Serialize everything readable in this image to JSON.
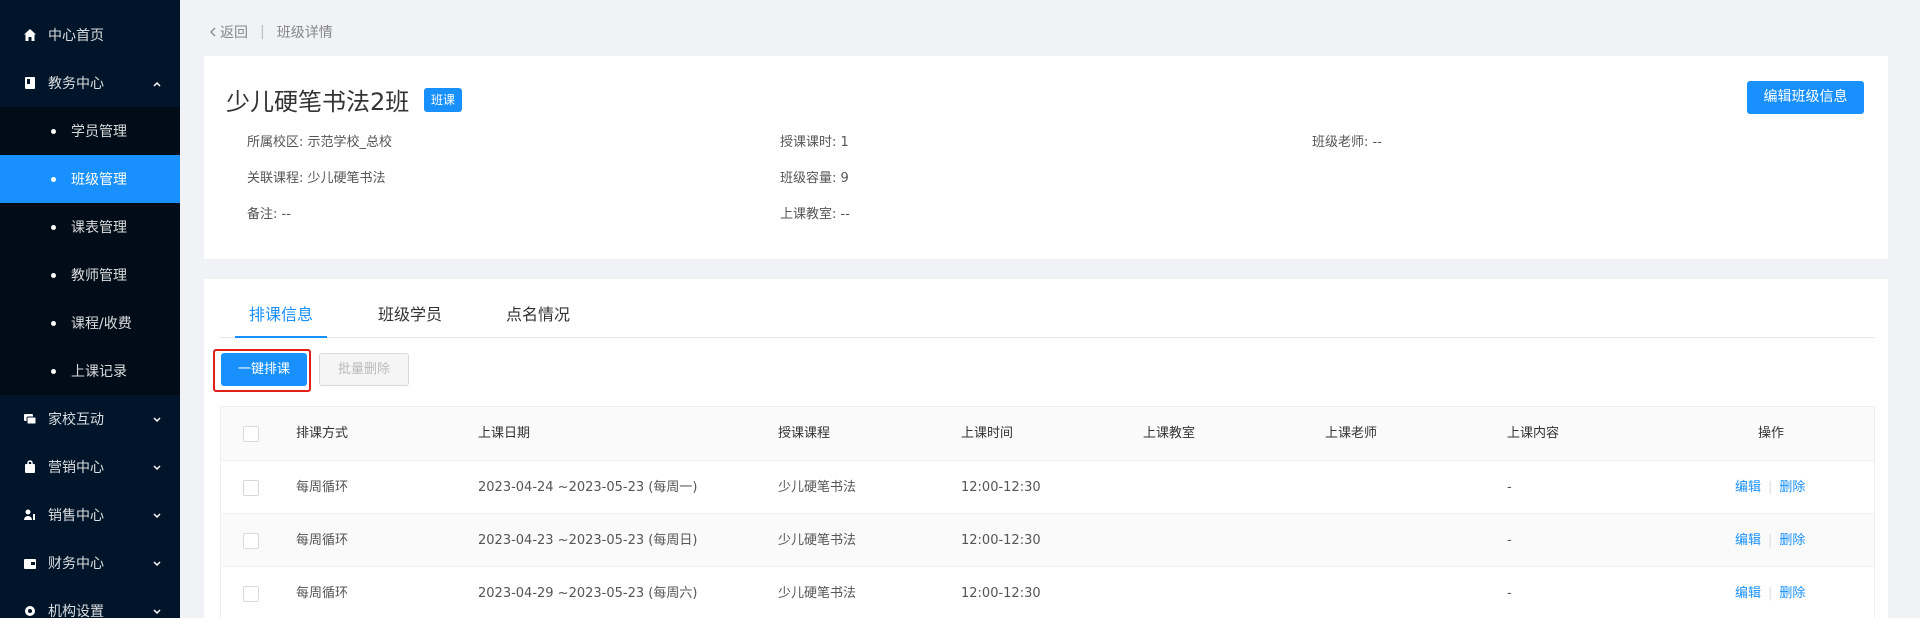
{
  "sidebar": {
    "home": "中心首页",
    "academic": "教务中心",
    "academic_items": [
      "学员管理",
      "班级管理",
      "课表管理",
      "教师管理",
      "课程/收费",
      "上课记录"
    ],
    "home_school": "家校互动",
    "marketing": "营销中心",
    "sales": "销售中心",
    "finance": "财务中心",
    "org_settings": "机构设置"
  },
  "breadcrumb": {
    "back": "返回",
    "separator": "|",
    "current": "班级详情"
  },
  "class_info": {
    "title": "少儿硬笔书法2班",
    "tag": "班课",
    "edit_button": "编辑班级信息",
    "campus": "所属校区: 示范学校_总校",
    "hours": "授课课时: 1",
    "teacher": "班级老师: --",
    "course": "关联课程: 少儿硬笔书法",
    "capacity": "班级容量: 9",
    "note": "备注: --",
    "classroom": "上课教室: --"
  },
  "tabs": [
    "排课信息",
    "班级学员",
    "点名情况"
  ],
  "buttons": {
    "one_click": "一键排课",
    "batch_delete": "批量删除"
  },
  "table": {
    "headers": [
      "排课方式",
      "上课日期",
      "授课课程",
      "上课时间",
      "上课教室",
      "上课老师",
      "上课内容",
      "操作"
    ],
    "rows": [
      {
        "mode": "每周循环",
        "date": "2023-04-24 ~2023-05-23 (每周一)",
        "course": "少儿硬笔书法",
        "time": "12:00-12:30",
        "classroom": "",
        "teacher": "",
        "content": "-",
        "edit": "编辑",
        "delete": "删除"
      },
      {
        "mode": "每周循环",
        "date": "2023-04-23 ~2023-05-23 (每周日)",
        "course": "少儿硬笔书法",
        "time": "12:00-12:30",
        "classroom": "",
        "teacher": "",
        "content": "-",
        "edit": "编辑",
        "delete": "删除"
      },
      {
        "mode": "每周循环",
        "date": "2023-04-29 ~2023-05-23 (每周六)",
        "course": "少儿硬笔书法",
        "time": "12:00-12:30",
        "classroom": "",
        "teacher": "",
        "content": "-",
        "edit": "编辑",
        "delete": "删除"
      }
    ]
  },
  "colors": {
    "sidebar_bg": "#001529",
    "submenu_bg": "#000c17",
    "primary": "#1890ff",
    "highlight_border": "#e0201a"
  }
}
